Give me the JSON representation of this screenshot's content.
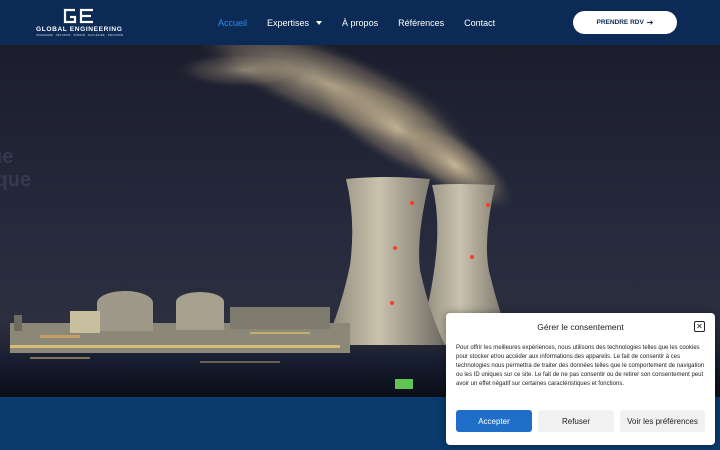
{
  "header": {
    "logo": {
      "mark": "GE",
      "name": "GLOBAL ENGINEERING",
      "tagline": "INGÉNIERIE · SÉCURITÉ · SÛRETÉ · NUCLÉAIRE · INDUSTRIE"
    },
    "nav": [
      {
        "label": "Accueil",
        "active": true
      },
      {
        "label": "Expertises",
        "dropdown": true
      },
      {
        "label": "À propos"
      },
      {
        "label": "Références"
      },
      {
        "label": "Contact"
      }
    ],
    "cta_label": "PRENDRE RDV",
    "cta_icon": "arrow-right-icon"
  },
  "hero": {
    "line1": "ue",
    "line2": "ique"
  },
  "consent": {
    "title": "Gérer le consentement",
    "close_icon": "close-icon",
    "body": "Pour offrir les meilleures expériences, nous utilisons des technologies telles que les cookies pour stocker et/ou accéder aux informations des appareils. Le fait de consentir à ces technologies nous permettra de traiter des données telles que le comportement de navigation ou les ID uniques sur ce site. Le fait de ne pas consentir ou de retirer son consentement peut avoir un effet négatif sur certaines caractéristiques et fonctions.",
    "accept_label": "Accepter",
    "refuse_label": "Refuser",
    "prefs_label": "Voir les préférences"
  },
  "colors": {
    "header_bg": "#0b2a55",
    "nav_active": "#2f8cf0",
    "accept_bg": "#1f6fc8",
    "footer_band": "#0a3a6e"
  }
}
